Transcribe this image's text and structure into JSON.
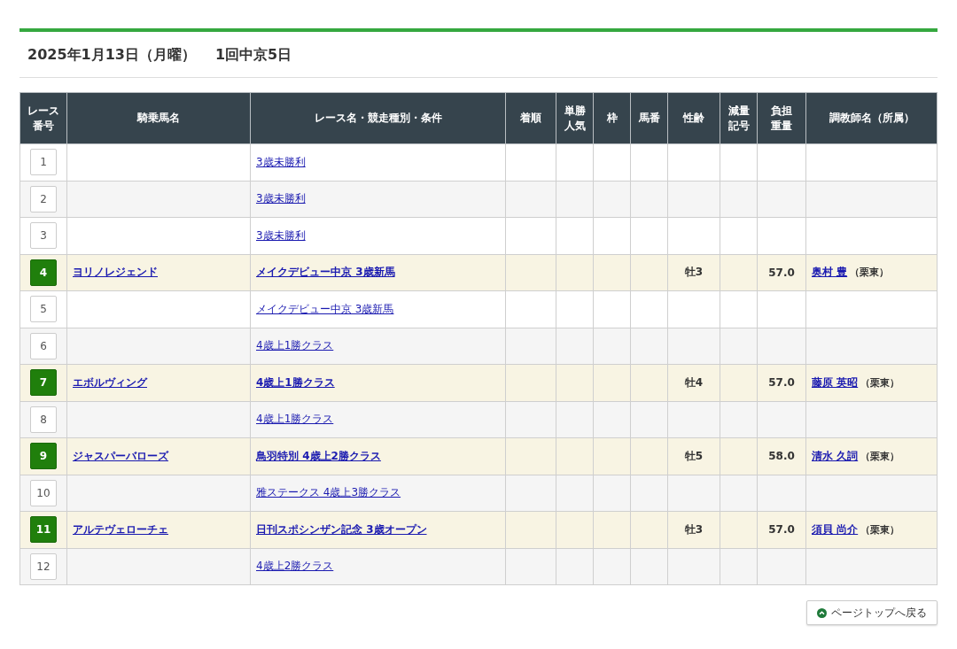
{
  "heading": {
    "date": "2025年1月13日（月曜）",
    "meeting": "1回中京5日"
  },
  "table": {
    "columns": [
      {
        "label": "レース番号"
      },
      {
        "label": "騎乗馬名"
      },
      {
        "label": "レース名・競走種別・条件"
      },
      {
        "label": "着順"
      },
      {
        "label": "単勝人気"
      },
      {
        "label": "枠"
      },
      {
        "label": "馬番"
      },
      {
        "label": "性齢"
      },
      {
        "label": "減量記号"
      },
      {
        "label": "負担重量"
      },
      {
        "label": "調教師名（所属）"
      }
    ],
    "rows": [
      {
        "number": "1",
        "selected": false,
        "race": "3歳未勝利"
      },
      {
        "number": "2",
        "selected": false,
        "race": "3歳未勝利"
      },
      {
        "number": "3",
        "selected": false,
        "race": "3歳未勝利"
      },
      {
        "number": "4",
        "selected": true,
        "horse": "ヨリノレジェンド",
        "race": "メイクデビュー中京 3歳新馬",
        "sex_age": "牡3",
        "weight": "57.0",
        "trainer": "奥村 豊",
        "affiliation": "（栗東）"
      },
      {
        "number": "5",
        "selected": false,
        "race": "メイクデビュー中京 3歳新馬"
      },
      {
        "number": "6",
        "selected": false,
        "race": "4歳上1勝クラス"
      },
      {
        "number": "7",
        "selected": true,
        "horse": "エボルヴィング",
        "race": "4歳上1勝クラス",
        "sex_age": "牡4",
        "weight": "57.0",
        "trainer": "藤原 英昭",
        "affiliation": "（栗東）"
      },
      {
        "number": "8",
        "selected": false,
        "race": "4歳上1勝クラス"
      },
      {
        "number": "9",
        "selected": true,
        "horse": "ジャスパーバローズ",
        "race": "鳥羽特別 4歳上2勝クラス",
        "sex_age": "牡5",
        "weight": "58.0",
        "trainer": "清水 久詞",
        "affiliation": "（栗東）"
      },
      {
        "number": "10",
        "selected": false,
        "race": "雅ステークス 4歳上3勝クラス"
      },
      {
        "number": "11",
        "selected": true,
        "horse": "アルテヴェローチェ",
        "race": "日刊スポシンザン記念 3歳オープン",
        "sex_age": "牡3",
        "weight": "57.0",
        "trainer": "須貝 尚介",
        "affiliation": "（栗東）"
      },
      {
        "number": "12",
        "selected": false,
        "race": "4歳上2勝クラス"
      }
    ]
  },
  "page_top_button": "ページトップへ戻る"
}
